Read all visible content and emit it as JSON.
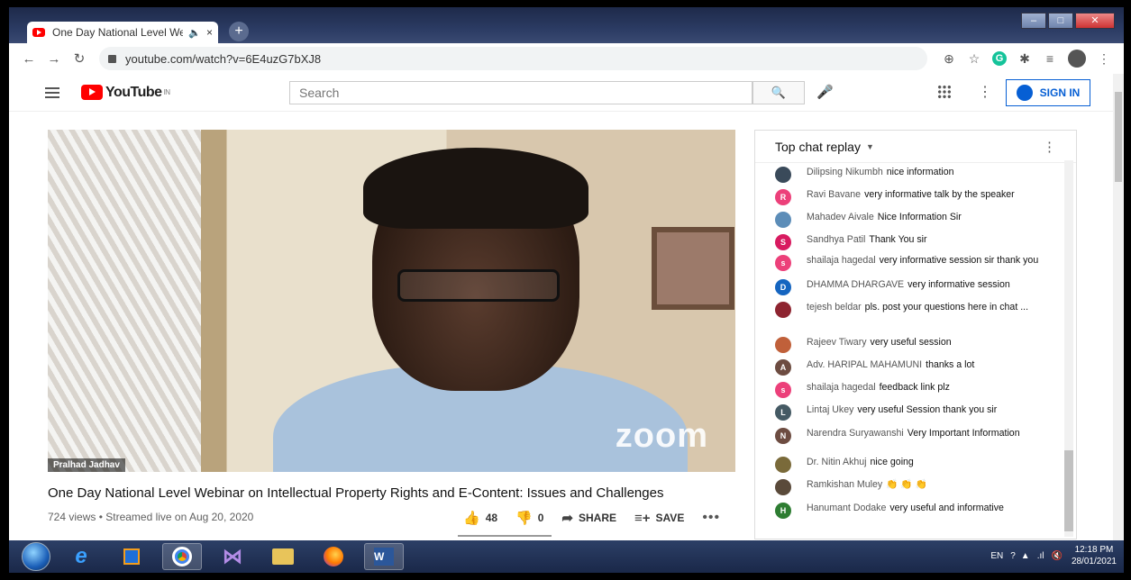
{
  "browser": {
    "tab_title": "One Day National Level Web",
    "tab_close": "×",
    "new_tab": "+",
    "url": "youtube.com/watch?v=6E4uzG7bXJ8",
    "win_minimize": "–",
    "win_maximize": "□",
    "win_close": "✕"
  },
  "youtube": {
    "logo_text": "YouTube",
    "region": "IN",
    "search_placeholder": "Search",
    "sign_in": "SIGN IN"
  },
  "video": {
    "speaker_name": "Pralhad Jadhav",
    "watermark": "zoom",
    "title": "One Day National Level Webinar on Intellectual Property Rights and E-Content: Issues and Challenges",
    "meta": "724 views • Streamed live on Aug 20, 2020",
    "likes": "48",
    "dislikes": "0",
    "share": "SHARE",
    "save": "SAVE",
    "more": "•••"
  },
  "chat": {
    "header": "Top chat replay",
    "messages": [
      {
        "author": "Dilipsing Nikumbh",
        "text": "nice information",
        "initial": "",
        "color": "#3a4a5a"
      },
      {
        "author": "Ravi Bavane",
        "text": "very informative talk by the speaker",
        "initial": "R",
        "color": "#ec407a"
      },
      {
        "author": "Mahadev Aivale",
        "text": "Nice Information Sir",
        "initial": "",
        "color": "#5c8db8"
      },
      {
        "author": "Sandhya Patil",
        "text": "Thank You sir",
        "initial": "S",
        "color": "#d81b60"
      },
      {
        "author": "shailaja hagedal",
        "text": "very informative session sir thank you",
        "initial": "s",
        "color": "#ec407a"
      },
      {
        "author": "DHAMMA DHARGAVE",
        "text": "very informative session",
        "initial": "D",
        "color": "#1565c0"
      },
      {
        "author": "tejesh beldar",
        "text": "pls. post your questions here in chat ...",
        "initial": "",
        "color": "#8e2430"
      },
      {
        "author": "Rajeev Tiwary",
        "text": "very useful session",
        "initial": "",
        "color": "#c0603a"
      },
      {
        "author": "Adv. HARIPAL MAHAMUNI",
        "text": "thanks a lot",
        "initial": "A",
        "color": "#6d4c41"
      },
      {
        "author": "shailaja hagedal",
        "text": "feedback link plz",
        "initial": "s",
        "color": "#ec407a"
      },
      {
        "author": "Lintaj Ukey",
        "text": "very useful Session thank you sir",
        "initial": "L",
        "color": "#455a64"
      },
      {
        "author": "Narendra Suryawanshi",
        "text": "Very Important Information",
        "initial": "N",
        "color": "#6d4c41"
      },
      {
        "author": "Dr. Nitin Akhuj",
        "text": "nice going",
        "initial": "",
        "color": "#7a6a3a"
      },
      {
        "author": "Ramkishan Muley",
        "text": "👏 👏 👏",
        "initial": "",
        "color": "#5a4a3a"
      },
      {
        "author": "Hanumant Dodake",
        "text": "very useful and informative",
        "initial": "H",
        "color": "#2e7d32"
      }
    ]
  },
  "taskbar": {
    "lang": "EN",
    "time": "12:18 PM",
    "date": "28/01/2021"
  }
}
